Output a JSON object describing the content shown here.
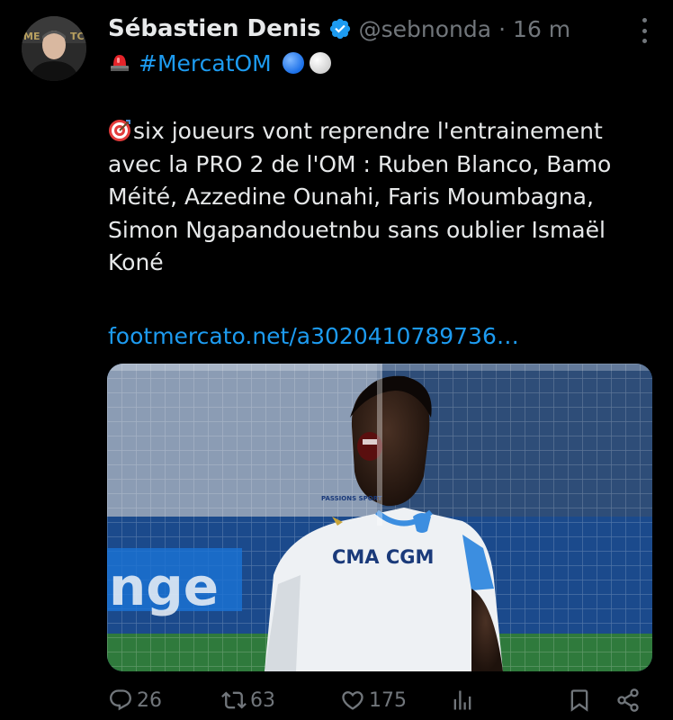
{
  "tweet": {
    "author_name": "Sébastien Denis",
    "handle": "@sebnonda",
    "separator": "·",
    "time": "16 m",
    "hashtag": "#MercatOM",
    "text": "six joueurs vont reprendre l'entrainement avec la PRO 2 de l'OM : Ruben Blanco, Bamo Méité, Azzedine Ounahi, Faris Moumbagna, Simon Ngapandouetnbu sans oublier Ismaël Koné",
    "link": "footmercato.net/a3020410789736…",
    "media": {
      "banner_text": "nge",
      "jersey_sponsor": "CMA CGM",
      "sleeve_text": "PASSIONS SPORT"
    }
  },
  "actions": {
    "replies": "26",
    "reposts": "63",
    "likes": "175"
  },
  "icons": {
    "verified": "verified-badge-icon",
    "siren": "siren-emoji-icon",
    "target": "direct-hit-emoji-icon",
    "reply": "reply-icon",
    "repost": "repost-icon",
    "like": "heart-icon",
    "views": "views-icon",
    "bookmark": "bookmark-icon",
    "share": "share-icon",
    "more": "more-icon"
  },
  "colors": {
    "background": "#000000",
    "text": "#e7e9ea",
    "muted": "#71767b",
    "accent": "#1d9bf0"
  }
}
